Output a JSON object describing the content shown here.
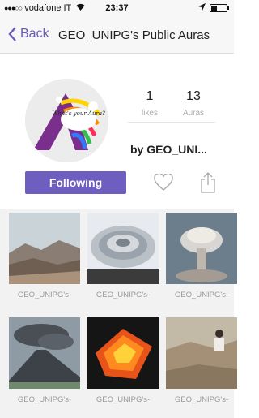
{
  "status_bar": {
    "signal": "●●●○○",
    "carrier": "vodafone IT",
    "wifi_icon": "wifi-icon",
    "time": "23:37",
    "location_icon": "location-arrow-icon",
    "battery_level": 0.35
  },
  "nav": {
    "back_label": "Back",
    "title": "GEO_UNIPG's Public Auras"
  },
  "profile": {
    "avatar_text": "What's your Aura?",
    "likes_value": "1",
    "likes_label": "likes",
    "auras_value": "13",
    "auras_label": "Auras",
    "author": "by GEO_UNI...",
    "follow_label": "Following",
    "heart_icon": "heart-outline-icon",
    "share_icon": "share-icon"
  },
  "colors": {
    "accent": "#6e5ec0",
    "link": "#6b5bb9"
  },
  "auras": [
    {
      "caption": "GEO_UNIPG's-",
      "image": "mountain-landscape"
    },
    {
      "caption": "GEO_UNIPG's-",
      "image": "spiral-earth-layers"
    },
    {
      "caption": "GEO_UNIPG's-",
      "image": "mushroom-cloud"
    },
    {
      "caption": "GEO_UNIPG's-",
      "image": "erupting-volcano"
    },
    {
      "caption": "GEO_UNIPG's-",
      "image": "lava-block"
    },
    {
      "caption": "GEO_UNIPG's-",
      "image": "rocky-outcrop-person"
    }
  ]
}
